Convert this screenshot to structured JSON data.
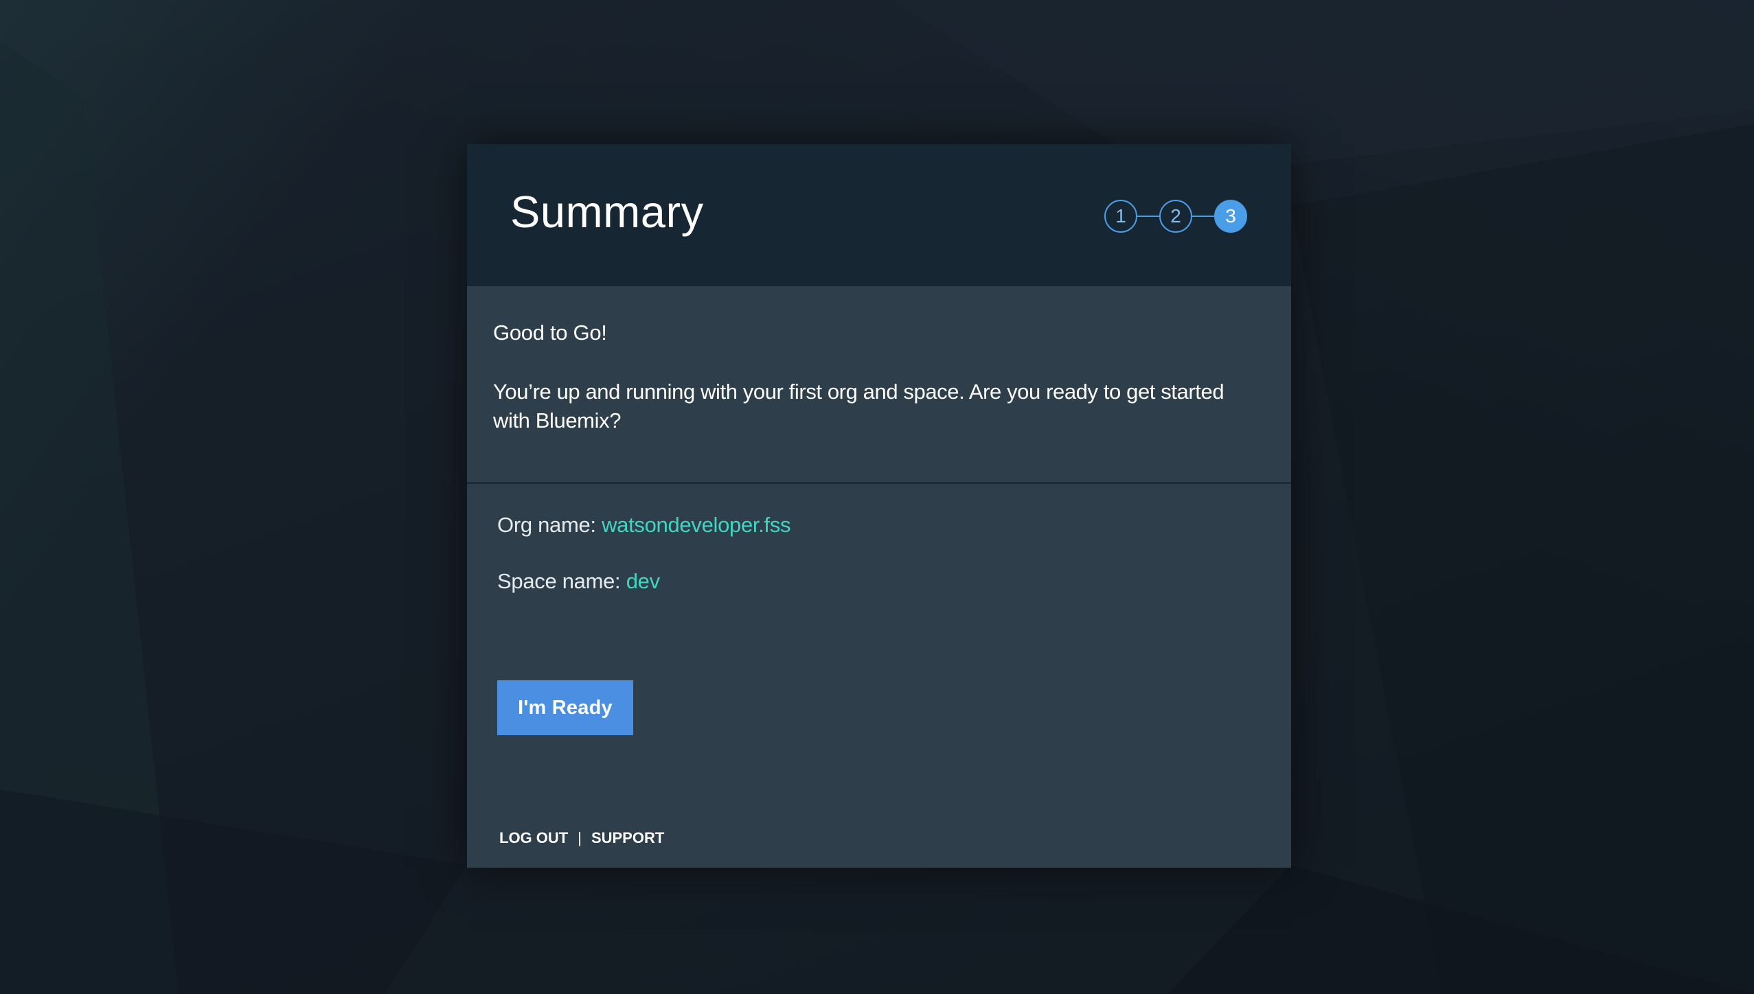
{
  "summary": {
    "title": "Summary",
    "steps": [
      "1",
      "2",
      "3"
    ],
    "active_step": 3,
    "heading": "Good to Go!",
    "message": "You’re up and running with your first org and space. Are you ready to get started with Bluemix?",
    "org_label": "Org name: ",
    "org_value": "watsondeveloper.fss",
    "space_label": "Space name: ",
    "space_value": "dev",
    "ready_button": "I'm Ready"
  },
  "footer": {
    "logout": "LOG OUT",
    "separator": "|",
    "support": "SUPPORT"
  },
  "colors": {
    "accent": "#4a8fe2",
    "value_text": "#41d6c3",
    "header_bg": "#162633",
    "card_bg": "#2e3f4b"
  }
}
